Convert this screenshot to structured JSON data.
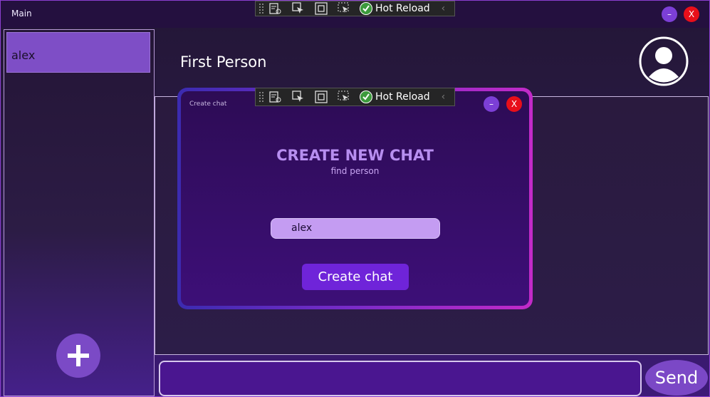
{
  "window": {
    "title": "Main",
    "minimize_label": "–",
    "close_label": "X"
  },
  "sidebar": {
    "contacts": [
      {
        "name": "alex"
      }
    ],
    "add_icon": "plus-icon"
  },
  "header": {
    "contact_name": "First Person",
    "avatar_icon": "user-avatar-icon"
  },
  "composer": {
    "input_value": "",
    "send_label": "Send"
  },
  "hot_reload_toolbar": {
    "label": "Hot Reload",
    "icons": [
      "live-tree-icon",
      "select-element-icon",
      "display-adorners-icon",
      "track-focus-icon",
      "hot-reload-check-icon"
    ]
  },
  "dialog": {
    "title": "Create chat",
    "heading": "CREATE NEW CHAT",
    "subheading": "find person",
    "search_value": "alex",
    "create_label": "Create chat",
    "minimize_label": "–",
    "close_label": "X"
  },
  "colors": {
    "accent": "#7b48c6",
    "close": "#e80f1a",
    "dialog_border_start": "#3b2bb0",
    "dialog_border_end": "#c32ac8"
  }
}
